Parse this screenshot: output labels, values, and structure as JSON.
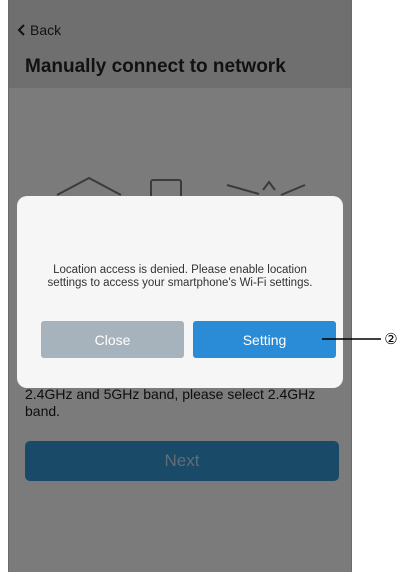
{
  "nav": {
    "back_label": "Back",
    "title": "Manually connect to network"
  },
  "background": {
    "instruction_text": "2.4GHz and 5GHz band, please select 2.4GHz band.",
    "next_label": "Next"
  },
  "dialog": {
    "message": "Location access is denied. Please enable location settings to access your smartphone's Wi-Fi settings.",
    "close_label": "Close",
    "setting_label": "Setting"
  },
  "callout": {
    "number": "②"
  },
  "colors": {
    "setting_button": "#2a8bd6",
    "close_button": "#a6b3bc",
    "next_button": "#194a68",
    "overlay": "#7b7b7b"
  },
  "icons": {
    "back": "chevron-left-icon",
    "illustration": [
      "router-icon",
      "phone-icon",
      "wifi-device-icon"
    ]
  }
}
